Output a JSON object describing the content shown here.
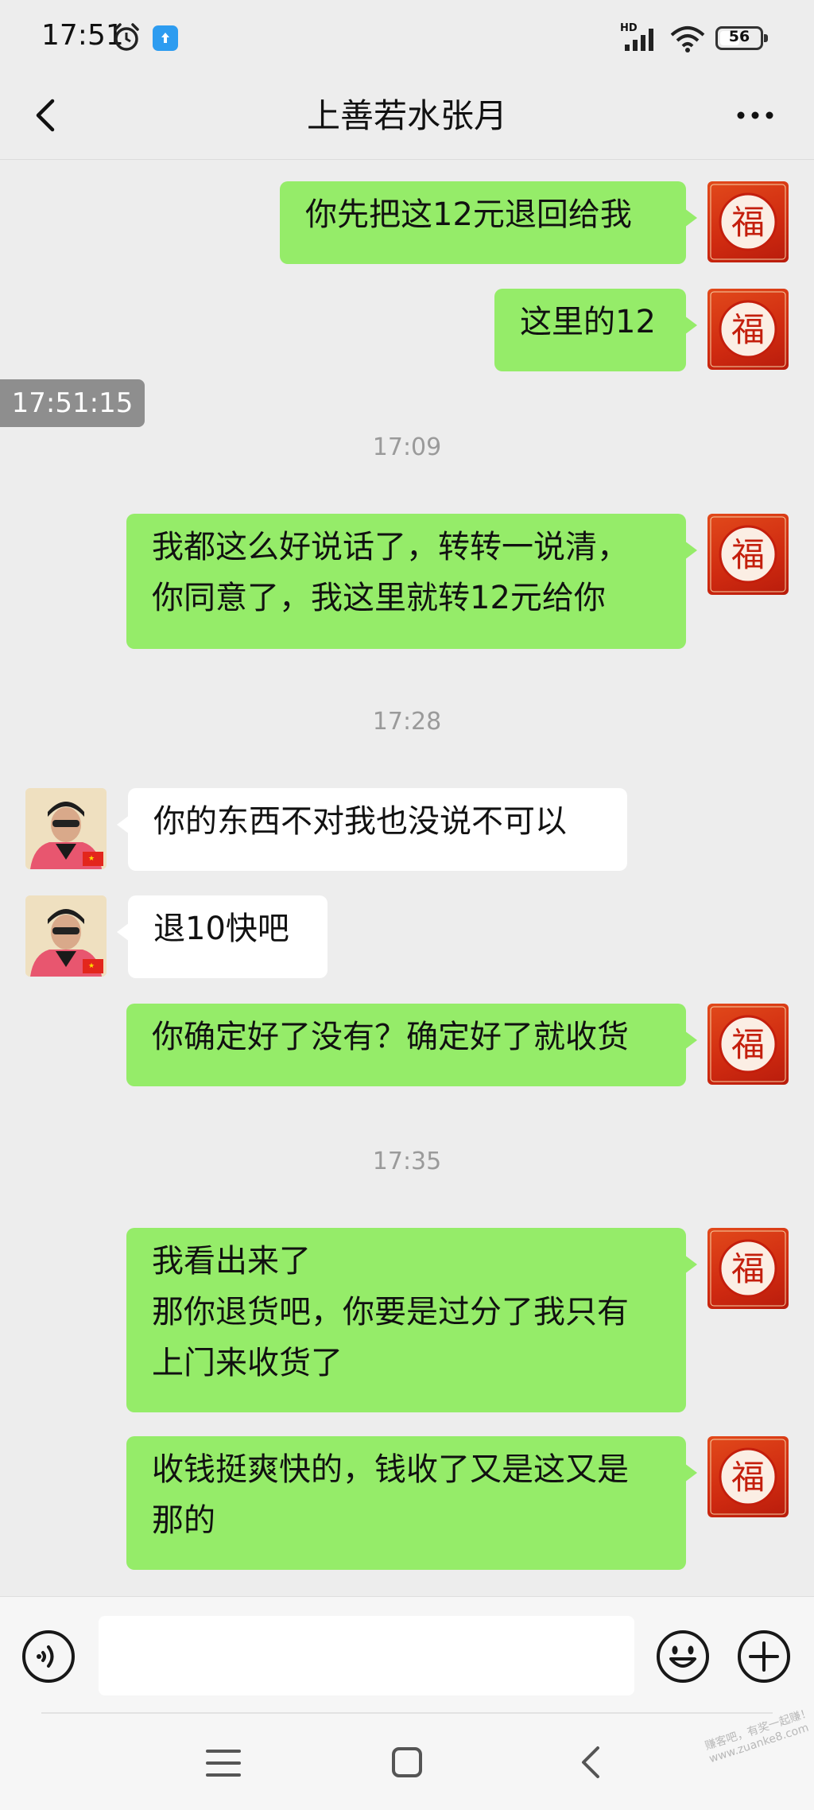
{
  "status_bar": {
    "time": "17:51",
    "hd_label": "HD",
    "battery": "56",
    "battery_level": 0.56
  },
  "header": {
    "title": "上善若水张月"
  },
  "overlay_time": "17:51:15",
  "messages": [
    {
      "text": "你先把这12元退回给我"
    },
    {
      "text": "这里的12"
    },
    {
      "text": "我都这么好说话了，转转一说清，\n你同意了，我这里就转12元给你"
    },
    {
      "text": "你的东西不对我也没说不可以"
    },
    {
      "text": "退10快吧"
    },
    {
      "text": "你确定好了没有？确定好了就收货"
    },
    {
      "text": "我看出来了\n那你退货吧，你要是过分了我只有\n上门来收货了"
    },
    {
      "text": "收钱挺爽快的，钱收了又是这又是\n那的"
    }
  ],
  "timestamps": [
    "17:09",
    "17:28",
    "17:35"
  ],
  "avatars": {
    "me": "fu-avatar-icon",
    "them": "person-avatar"
  },
  "colors": {
    "my_bubble": "#95ec69",
    "their_bubble": "#ffffff",
    "background": "#ededed",
    "avatar_red": "#d42e12"
  },
  "watermark": "赚客吧，有奖一起赚！www.zuanke8.com"
}
